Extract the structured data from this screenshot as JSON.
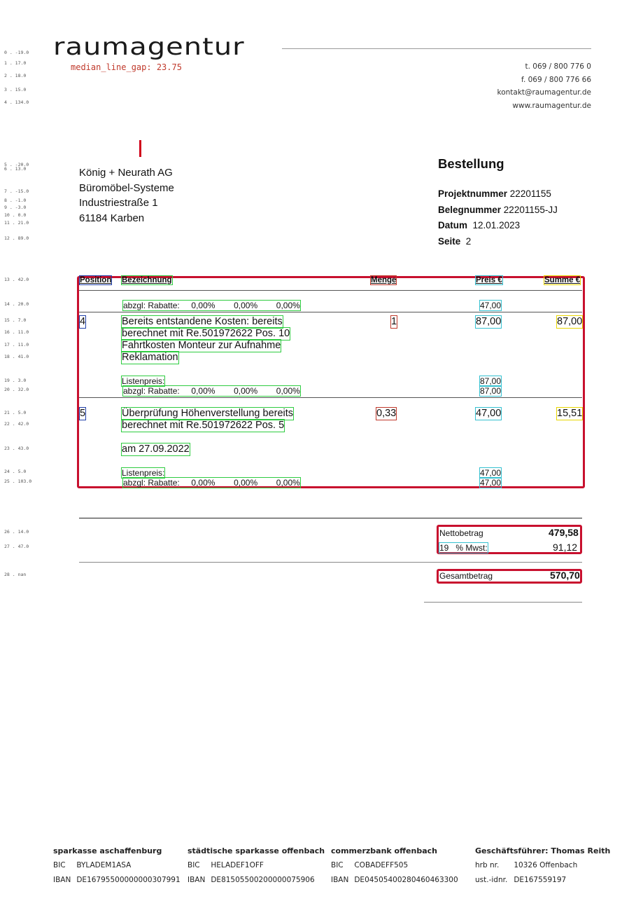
{
  "header": {
    "logo": "raumagentur",
    "overlay_label": "median_line_gap: 23.75",
    "contact": [
      "t. 069 / 800 776 0",
      "f. 069 / 800 776 66",
      "kontakt@raumagentur.de",
      "www.raumagentur.de"
    ]
  },
  "line_markers": [
    "0 . -19.0",
    "1 . 17.0",
    "2 . 18.0",
    "3 . 15.0",
    "4 . 134.0",
    "5 . -20.0",
    "6 . 13.0",
    "7 . -15.0",
    "8 . -1.0",
    "9 . -3.0",
    "10 . 0.0",
    "11 . 21.0",
    "12 . 89.0",
    "13 . 42.0",
    "14 . 20.0",
    "15 . 7.0",
    "16 . 11.0",
    "17 . 11.0",
    "18 . 41.0",
    "19 . 3.0",
    "20 . 32.0",
    "21 . 5.0",
    "22 . 42.0",
    "23 . 43.0",
    "24 . 5.0",
    "25 . 103.0",
    "26 . 14.0",
    "27 . 47.0",
    "28 . nan"
  ],
  "recipient": [
    "König + Neurath AG",
    "Büromöbel-Systeme",
    "Industriestraße 1",
    "61184 Karben"
  ],
  "doc": {
    "title": "Bestellung",
    "project_label": "Projektnummer",
    "project_value": "22201155",
    "beleg_label": "Belegnummer",
    "beleg_value": "22201155-JJ",
    "date_label": "Datum",
    "date_value": "12.01.2023",
    "page_label": "Seite",
    "page_value": "2"
  },
  "table": {
    "headers": {
      "position": "Position",
      "bezeichnung": "Bezeichnung",
      "menge": "Menge",
      "preis": "Preis €",
      "summe": "Summe €"
    },
    "top_rabatt": {
      "text": "abzgl: Rabatte:     0,00%        0,00%        0,00%",
      "price": "47,00"
    },
    "items": [
      {
        "pos": "4",
        "lines": [
          "Bereits entstandene Kosten:  bereits",
          "berechnet mit Re.501972622 Pos. 10",
          "Fahrtkosten Monteur zur Aufnahme",
          "Reklamation"
        ],
        "qty": "1",
        "price": "87,00",
        "sum": "87,00",
        "listenpreis_label": "Listenpreis:",
        "listenpreis": "87,00",
        "rabatt": "abzgl: Rabatte:     0,00%        0,00%        0,00%",
        "rabatt_price": "87,00"
      },
      {
        "pos": "5",
        "lines": [
          "Überprüfung Höhenverstellung  bereits",
          "berechnet mit Re.501972622 Pos. 5"
        ],
        "extra_line": "am 27.09.2022",
        "qty": "0,33",
        "price": "47,00",
        "sum": "15,51",
        "listenpreis_label": "Listenpreis:",
        "listenpreis": "47,00",
        "rabatt": "abzgl: Rabatte:     0,00%        0,00%        0,00%",
        "rabatt_price": "47,00"
      }
    ]
  },
  "totals": {
    "netto_label": "Nettobetrag",
    "netto_value": "479,58",
    "mwst_label": "19   % Mwst:",
    "mwst_value": "91,12",
    "gesamt_label": "Gesamtbetrag",
    "gesamt_value": "570,70"
  },
  "footer": [
    {
      "title": "sparkasse aschaffenburg",
      "l1_label": "BIC",
      "l1": "BYLADEM1ASA",
      "l2_label": "IBAN",
      "l2": "DE16795500000000307991"
    },
    {
      "title": "städtische sparkasse offenbach",
      "l1_label": "BIC",
      "l1": "HELADEF1OFF",
      "l2_label": "IBAN",
      "l2": "DE81505500200000075906"
    },
    {
      "title": "commerzbank offenbach",
      "l1_label": "BIC",
      "l1": "COBADEFF505",
      "l2_label": "IBAN",
      "l2": "DE04505400280460463300"
    },
    {
      "title": "Geschäftsführer: Thomas Reith",
      "l1_label": "hrb nr.",
      "l1": "10326 Offenbach",
      "l2_label": "ust.-idnr.",
      "l2": "DE167559197"
    }
  ]
}
